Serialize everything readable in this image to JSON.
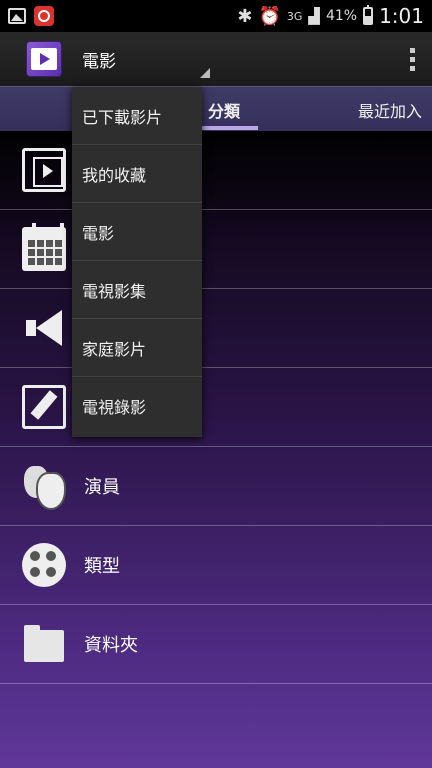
{
  "status_bar": {
    "battery_pct": "41%",
    "time": "1:01",
    "network": "3G"
  },
  "action_bar": {
    "title": "電影"
  },
  "tabs": {
    "active": "分類",
    "recent": "最近加入"
  },
  "list_items": [
    {
      "label": "",
      "icon": "film-stack-icon"
    },
    {
      "label": "",
      "icon": "calendar-icon"
    },
    {
      "label": "",
      "icon": "megaphone-icon"
    },
    {
      "label": "",
      "icon": "edit-icon"
    },
    {
      "label": "演員",
      "icon": "masks-icon"
    },
    {
      "label": "類型",
      "icon": "film-reel-icon"
    },
    {
      "label": "資料夾",
      "icon": "folder-icon"
    }
  ],
  "dropdown": {
    "items": [
      "已下載影片",
      "我的收藏",
      "電影",
      "電視影集",
      "家庭影片",
      "電視錄影"
    ]
  }
}
